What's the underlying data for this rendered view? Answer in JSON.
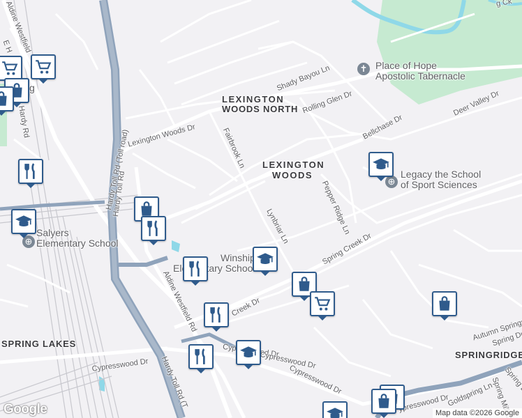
{
  "map": {
    "areas": [
      {
        "id": "lexington-woods-north",
        "line1": "LEXINGTON",
        "line2": "WOODS NORTH"
      },
      {
        "id": "lexington-woods",
        "line1": "LEXINGTON",
        "line2": "WOODS"
      },
      {
        "id": "spring-lakes",
        "line1": "SPRING LAKES"
      },
      {
        "id": "springridge",
        "line1": "SPRINGRIDGE"
      }
    ],
    "streets": {
      "aldine_westfield_top": "Aldine Westfield",
      "e_h": "E H",
      "n_hardy_rd": "N Hardy Rd",
      "hardy_toll_rd_toll": "Hardy Toll Rd (Toll road)",
      "hardy_toll_rd": "Hardy Toll Rd",
      "hardy_toll_rd_bottom": "Hardy Toll Rd (T",
      "aldine_westfield_rd": "Aldine Westfield Rd",
      "lexington_woods_dr": "Lexington Woods Dr",
      "fairbrook_ln": "Fairbrook Ln",
      "shady_bayou_ln": "Shady Bayou Ln",
      "rolling_glen_dr": "Rolling Glen Dr",
      "bellchase_dr": "Bellchase Dr",
      "deer_valley_dr": "Deer Valley Dr",
      "pepper_ridge_ln": "Pepper Ridge Ln",
      "lynbriar_ln": "Lynbriar Ln",
      "spring_creek_dr": "Spring Creek Dr",
      "creek_dr": "Creek Dr",
      "cypresswood_dr_1": "Cypresswood Dr",
      "cypresswood_dr_2": "Cypresswood Dr",
      "cypresswood_dr_3": "Cypresswood Dr",
      "cypresswood_dr_4": "Cypresswood Dr",
      "cypresswood_dr_5": "ypresswood Dr",
      "autumn_springs": "Autumn Springs L",
      "spring_dust": "Spring Dus",
      "goldspring_ln": "Goldspring Ln",
      "spring_mill": "Spring Mill L",
      "spring_d": "Spring D",
      "top_right_ck": "g Ck",
      "left_edge_g": "g"
    },
    "pois": {
      "place_of_hope": {
        "line1": "Place of Hope",
        "line2": "Apostolic Tabernacle"
      },
      "legacy_school": {
        "line1": "Legacy the School",
        "line2": "of Sport Sciences"
      },
      "salyers": {
        "line1": "Salyers",
        "line2": "Elementary School"
      },
      "winship": {
        "line1": "Winship",
        "line2": "Elementary School"
      }
    },
    "markers": [
      {
        "type": "shopping-cart"
      },
      {
        "type": "shopping-bag"
      },
      {
        "type": "restaurant"
      },
      {
        "type": "school"
      },
      {
        "type": "shopping-bag"
      },
      {
        "type": "restaurant"
      },
      {
        "type": "restaurant"
      },
      {
        "type": "school"
      },
      {
        "type": "school"
      },
      {
        "type": "shopping-bag"
      },
      {
        "type": "shopping-cart"
      },
      {
        "type": "restaurant"
      },
      {
        "type": "restaurant"
      },
      {
        "type": "school"
      },
      {
        "type": "shopping-bag"
      },
      {
        "type": "school"
      },
      {
        "type": "shopping-bag"
      }
    ],
    "colors": {
      "park": "#c6ead1",
      "water": "#8fd8e8",
      "highway": "#8fa3bb",
      "rail": "#c5c5cb",
      "marker_border": "#2f5b8c"
    },
    "logo": "Google",
    "attribution": "Map data ©2026 Google"
  }
}
